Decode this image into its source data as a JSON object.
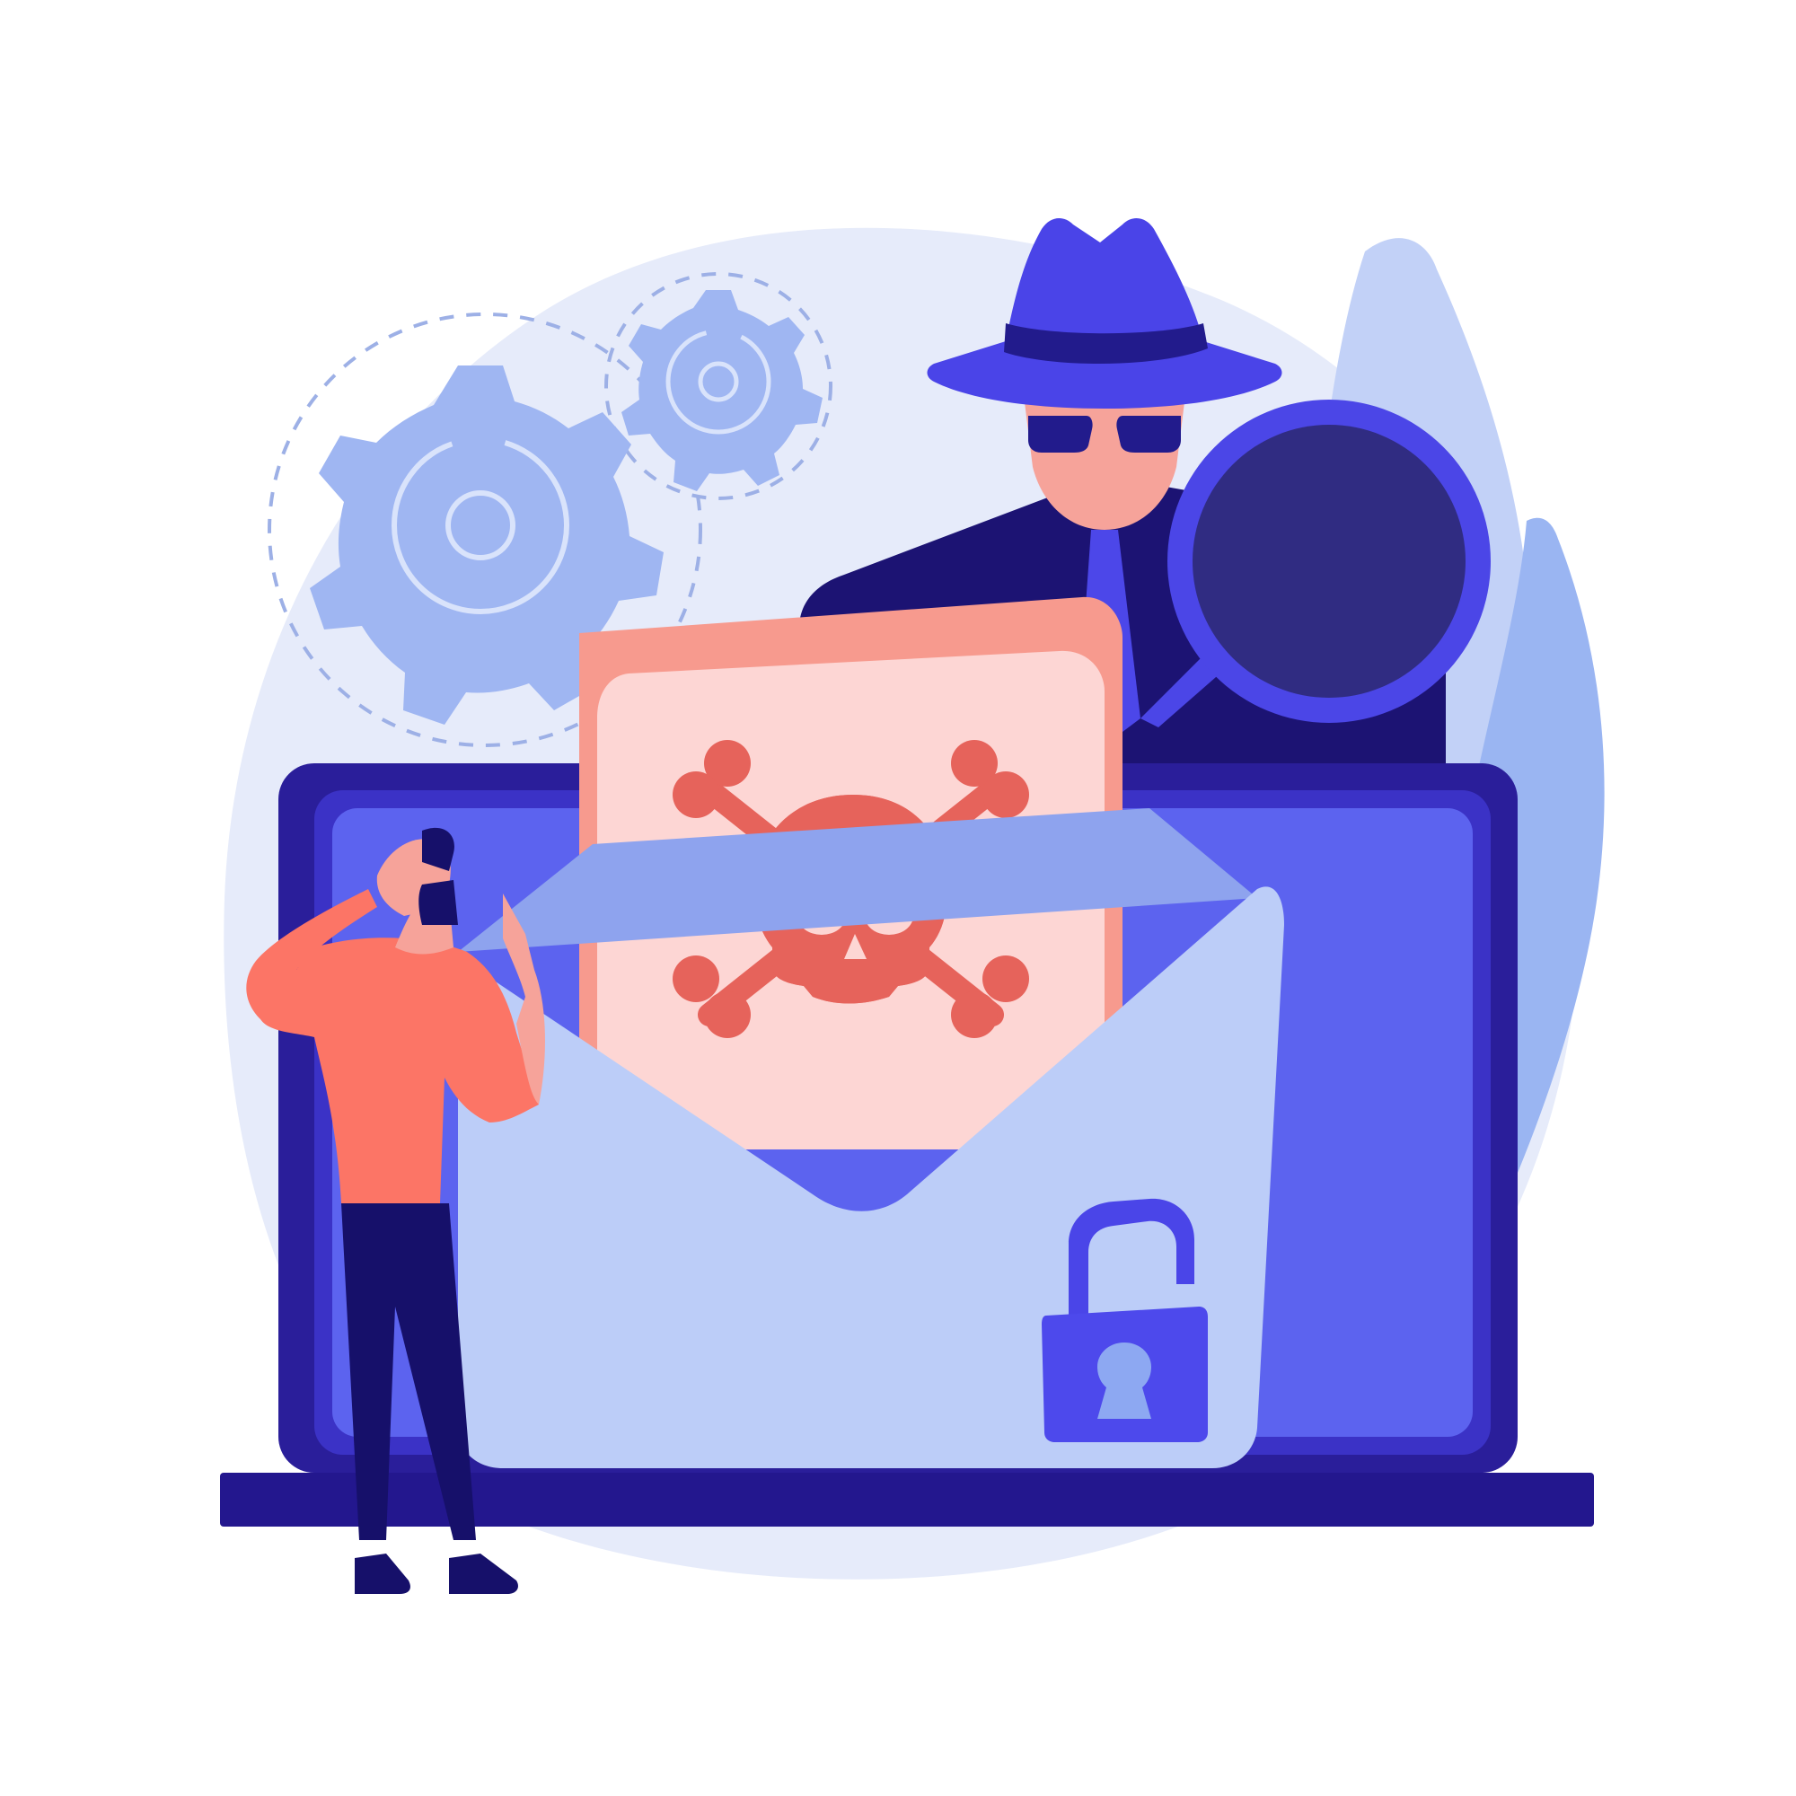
{
  "illustration": {
    "colors": {
      "background": "#ffffff",
      "backdrop": "#e6ebfa",
      "gear": "#9fb6f2",
      "gear_line": "#d9e3fb",
      "dashes": "#9db0e6",
      "leaf_light": "#c2d1f7",
      "leaf_mid": "#9ab5f2",
      "laptop_dark": "#2a1e9a",
      "laptop_frame": "#3b32c6",
      "laptop_screen": "#5c63ef",
      "laptop_base": "#23178e",
      "envelope": "#bccdf8",
      "envelope_shadow": "#8ea3ee",
      "letter_back": "#f79a8e",
      "letter_front": "#fdd6d4",
      "skull": "#e6635b",
      "spy_hat": "#4a44e8",
      "spy_hat_band": "#221b8c",
      "spy_coat": "#1c1373",
      "spy_skin": "#f6a39a",
      "spy_tie": "#4c47e9",
      "glass_ring": "#4b46e7",
      "glass_lens": "#2e2a7a",
      "lock_body": "#4d49ec",
      "lock_shackle": "#4a45e8",
      "lock_keyhole": "#8da8f2",
      "person_shirt": "#fc7566",
      "person_skin": "#f6a39a",
      "person_pants": "#16106a",
      "person_hair": "#16106a"
    },
    "icons": [
      "gear-icon",
      "skull-crossbones-icon",
      "unlocked-padlock-icon",
      "magnifying-glass-icon"
    ]
  }
}
